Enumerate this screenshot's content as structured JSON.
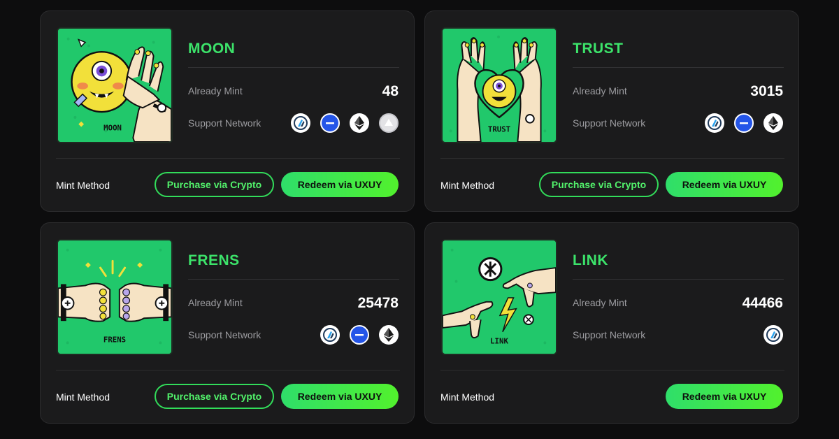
{
  "labels": {
    "already_mint": "Already Mint",
    "support_network": "Support Network",
    "mint_method": "Mint Method",
    "purchase_button": "Purchase via Crypto",
    "redeem_button": "Redeem via UXUY"
  },
  "colors": {
    "page_background": "#0d0d0e",
    "card_background": "#1b1b1c",
    "title_green": "#3ce36a",
    "art_green": "#21c86b",
    "button_gradient_start": "#2fde6a",
    "button_gradient_end": "#52f12d"
  },
  "cards": [
    {
      "title": "MOON",
      "art_caption": "MOON",
      "already_mint": "48",
      "networks": [
        "arbitrum-icon",
        "base-icon",
        "ethereum-icon",
        "silver-token-icon"
      ],
      "buttons": [
        "purchase",
        "redeem"
      ]
    },
    {
      "title": "TRUST",
      "art_caption": "TRUST",
      "already_mint": "3015",
      "networks": [
        "arbitrum-icon",
        "base-icon",
        "ethereum-icon"
      ],
      "buttons": [
        "purchase",
        "redeem"
      ]
    },
    {
      "title": "FRENS",
      "art_caption": "FRENS",
      "already_mint": "25478",
      "networks": [
        "arbitrum-icon",
        "base-icon",
        "ethereum-icon"
      ],
      "buttons": [
        "purchase",
        "redeem"
      ]
    },
    {
      "title": "LINK",
      "art_caption": "LINK",
      "already_mint": "44466",
      "networks": [
        "arbitrum-icon"
      ],
      "buttons": [
        "redeem"
      ]
    }
  ]
}
